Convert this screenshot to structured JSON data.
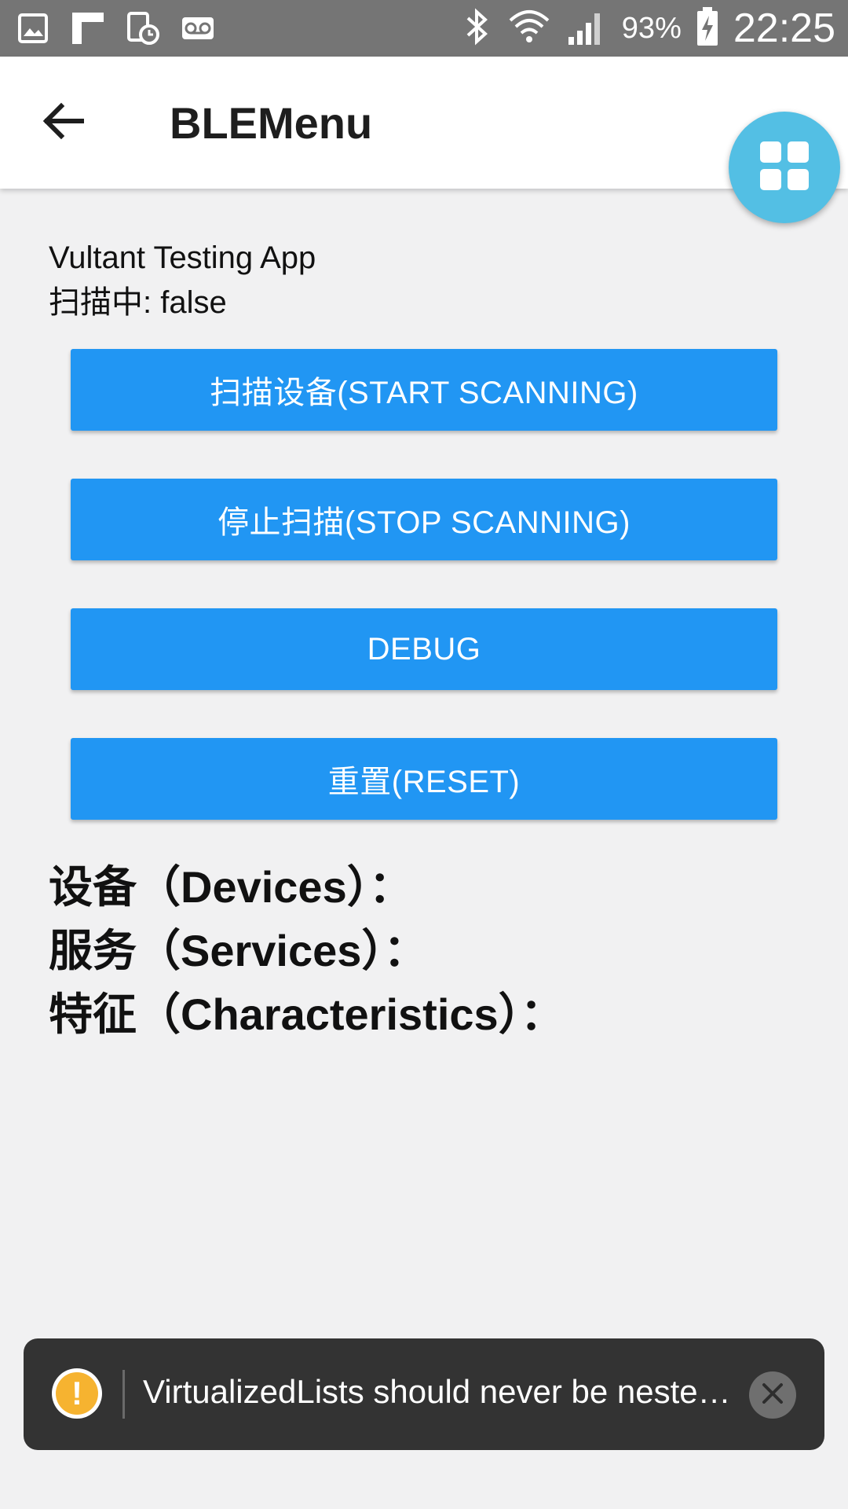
{
  "status_bar": {
    "battery_percent": "93%",
    "clock": "22:25",
    "left_icons": [
      "image-icon",
      "flipboard-icon",
      "alarm-clock-icon",
      "voicemail-icon"
    ],
    "right_icons": [
      "bluetooth-icon",
      "wifi-icon",
      "signal-icon",
      "battery-charging-icon"
    ]
  },
  "app_bar": {
    "title": "BLEMenu",
    "back_icon": "arrow-left-icon",
    "fab_icon": "grid-icon",
    "fab_color": "#53bfe4"
  },
  "intro": {
    "app_name": "Vultant Testing App",
    "scanning_status": "扫描中: false"
  },
  "buttons": {
    "start_scanning": "扫描设备(START SCANNING)",
    "stop_scanning": "停止扫描(STOP SCANNING)",
    "debug": "DEBUG",
    "reset": "重置(RESET)",
    "color": "#2196f3"
  },
  "sections": {
    "devices": "设备（Devices）：",
    "services": "服务（Services）：",
    "characteristics": "特征（Characteristics）："
  },
  "toast": {
    "icon": "warning-icon",
    "icon_glyph": "!",
    "message": "VirtualizedLists should never be nested inside plain ScrollViews with the same orientation",
    "close_icon": "close-icon",
    "warning_color": "#f6b330"
  }
}
